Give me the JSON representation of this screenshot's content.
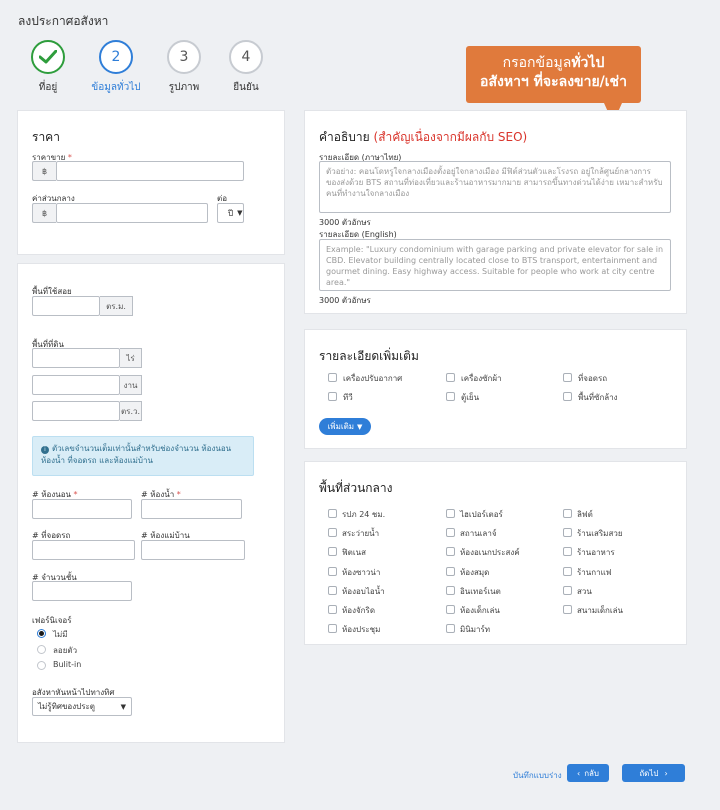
{
  "page": {
    "title": "ลงประกาศอสังหา"
  },
  "steps": [
    {
      "num": "✓",
      "label": "ที่อยู่"
    },
    {
      "num": "2",
      "label": "ข้อมูลทั่วไป"
    },
    {
      "num": "3",
      "label": "รูปภาพ"
    },
    {
      "num": "4",
      "label": "ยืนยัน"
    }
  ],
  "callout": {
    "line1_pre": "กรอกข้อมูล",
    "line1_bold": "ทั่วไป",
    "line2": "อสังหาฯ ที่จะลงขาย/เช่า"
  },
  "price": {
    "title": "ราคา",
    "sale_label": "ราคาขาย",
    "req": "*",
    "currency": "฿",
    "common_label": "ค่าส่วนกลาง",
    "per_label": "ต่อ",
    "per_value": "ปี"
  },
  "area": {
    "usable_label": "พื้นที่ใช้สอย",
    "usable_unit": "ตร.ม.",
    "land_label": "พื้นที่ที่ดิน",
    "unit_rai": "ไร่",
    "unit_ngan": "งาน",
    "unit_sqwa": "ตร.ว.",
    "info": "ตัวเลขจำนวนเต็มเท่านั้นสำหรับช่องจำนวน ห้องนอน ห้องน้ำ ที่จอดรถ และห้องแม่บ้าน"
  },
  "rooms": {
    "bedroom": "# ห้องนอน",
    "bathroom": "# ห้องน้ำ",
    "parking": "# ที่จอดรถ",
    "maid": "# ห้องแม่บ้าน",
    "floors": "# จำนวนชั้น",
    "req": "*"
  },
  "furniture": {
    "label": "เฟอร์นิเจอร์",
    "options": [
      "ไม่มี",
      "ลอยตัว",
      "Bulit-in"
    ],
    "selected": 0
  },
  "direction": {
    "label": "อสังหาหันหน้าไปทางทิศ",
    "value": "ไม่รู้ทิศของประตู"
  },
  "description": {
    "title_pre": "คำอธิบาย",
    "title_note": "(สำคัญเนื่องจากมีผลกับ SEO)",
    "th_label": "รายละเอียด (ภาษาไทย)",
    "th_placeholder": "ตัวอย่าง: คอนโดหรูใจกลางเมืองตั้งอยู่ใจกลางเมือง มีฟิต์ส่วนตัวและโรงรถ อยู่ใกล้ศูนย์กลางการของส่งด้วย BTS สถานที่ท่องเที่ยวและร้านอาหารมากมาย สามารถขึ้นทางด่วนได้ง่าย เหมาะสำหรับคนที่ทำงานใจกลางเมือง",
    "th_count": "3000 ตัวอักษร",
    "en_label": "รายละเอียด (English)",
    "en_placeholder": "Example: \"Luxury condominium with garage parking and private elevator for sale in CBD. Elevator building centrally located close to BTS transport, entertainment and gourmet dining. Easy highway access. Suitable for people who work at city centre area.\"",
    "en_count": "3000 ตัวอักษร"
  },
  "extra": {
    "title": "รายละเอียดเพิ่มเติม",
    "items": [
      "เครื่องปรับอากาศ",
      "เครื่องซักผ้า",
      "ที่จอดรถ",
      "ทีวี",
      "ตู้เย็น",
      "พื้นที่ซักล้าง"
    ],
    "more_label": "เพิ่มเติม"
  },
  "common": {
    "title": "พื้นที่ส่วนกลาง",
    "items": [
      "รปภ 24 ชม.",
      "ไฮเปอร์เตอร์",
      "ลิฟต์",
      "สระว่ายน้ำ",
      "สถานเลาจ์",
      "ร้านเสริมสวย",
      "ฟิตเนส",
      "ห้องอเนกประสงค์",
      "ร้านอาหาร",
      "ห้องซาวน่า",
      "ห้องสมุด",
      "ร้านกาแฟ",
      "ห้องอบไอน้ำ",
      "อินเทอร์เนต",
      "สวน",
      "ห้องจักริด",
      "ห้องเด็กเล่น",
      "สนามเด็กเล่น",
      "ห้องประชุม",
      "มินิมาร์ท"
    ]
  },
  "footer": {
    "draft": "บันทึกแบบร่าง",
    "back": "กลับ",
    "next": "ถัดไป"
  },
  "colors": {
    "primary": "#2f7ed8",
    "success": "#2e9d3c",
    "callout": "#e07a3c",
    "seo_note": "#d9342b"
  }
}
